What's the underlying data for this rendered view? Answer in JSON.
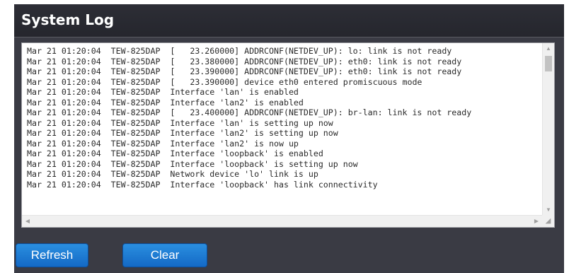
{
  "panel": {
    "title": "System Log"
  },
  "log": {
    "lines": [
      "Mar 21 01:20:04  TEW-825DAP  [   23.260000] ADDRCONF(NETDEV_UP): lo: link is not ready",
      "Mar 21 01:20:04  TEW-825DAP  [   23.380000] ADDRCONF(NETDEV_UP): eth0: link is not ready",
      "Mar 21 01:20:04  TEW-825DAP  [   23.390000] ADDRCONF(NETDEV_UP): eth0: link is not ready",
      "Mar 21 01:20:04  TEW-825DAP  [   23.390000] device eth0 entered promiscuous mode",
      "Mar 21 01:20:04  TEW-825DAP  Interface 'lan' is enabled",
      "Mar 21 01:20:04  TEW-825DAP  Interface 'lan2' is enabled",
      "Mar 21 01:20:04  TEW-825DAP  [   23.400000] ADDRCONF(NETDEV_UP): br-lan: link is not ready",
      "Mar 21 01:20:04  TEW-825DAP  Interface 'lan' is setting up now",
      "Mar 21 01:20:04  TEW-825DAP  Interface 'lan2' is setting up now",
      "Mar 21 01:20:04  TEW-825DAP  Interface 'lan2' is now up",
      "Mar 21 01:20:04  TEW-825DAP  Interface 'loopback' is enabled",
      "Mar 21 01:20:04  TEW-825DAP  Interface 'loopback' is setting up now",
      "Mar 21 01:20:04  TEW-825DAP  Network device 'lo' link is up",
      "Mar 21 01:20:04  TEW-825DAP  Interface 'loopback' has link connectivity"
    ]
  },
  "buttons": {
    "refresh_label": "Refresh",
    "clear_label": "Clear"
  },
  "colors": {
    "panel_bg": "#3a3b44",
    "header_bg": "#2d2e36",
    "button_accent": "#1a7bd6"
  }
}
